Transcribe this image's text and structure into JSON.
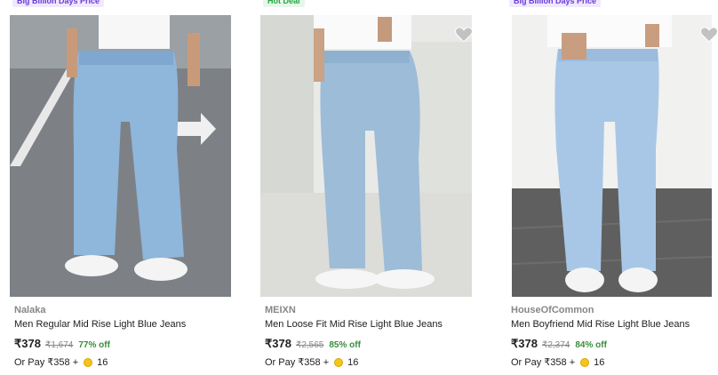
{
  "products": [
    {
      "tag": "Big Billion Days Price",
      "brand": "Nalaka",
      "title": "Men Regular Mid Rise Light Blue Jeans",
      "price": "₹378",
      "mrp": "₹1,674",
      "discount": "77% off",
      "or_pay_label": "Or Pay ₹358 +",
      "coins": "16"
    },
    {
      "tag": "Hot Deal",
      "brand": "MEIXN",
      "title": "Men Loose Fit Mid Rise Light Blue Jeans",
      "price": "₹378",
      "mrp": "₹2,565",
      "discount": "85% off",
      "or_pay_label": "Or Pay ₹358 +",
      "coins": "16"
    },
    {
      "tag": "Big Billion Days Price",
      "brand": "HouseOfCommon",
      "title": "Men Boyfriend Mid Rise Light Blue Jeans",
      "price": "₹378",
      "mrp": "₹2,374",
      "discount": "84% off",
      "or_pay_label": "Or Pay ₹358 +",
      "coins": "16"
    }
  ],
  "colors": {
    "discount": "#388e3c",
    "tag_bbd": "#6b3bd6",
    "tag_hot": "#26a541",
    "coin": "#f5c518"
  },
  "icons": {
    "wishlist": "heart-icon",
    "coin": "supercoin-icon"
  }
}
